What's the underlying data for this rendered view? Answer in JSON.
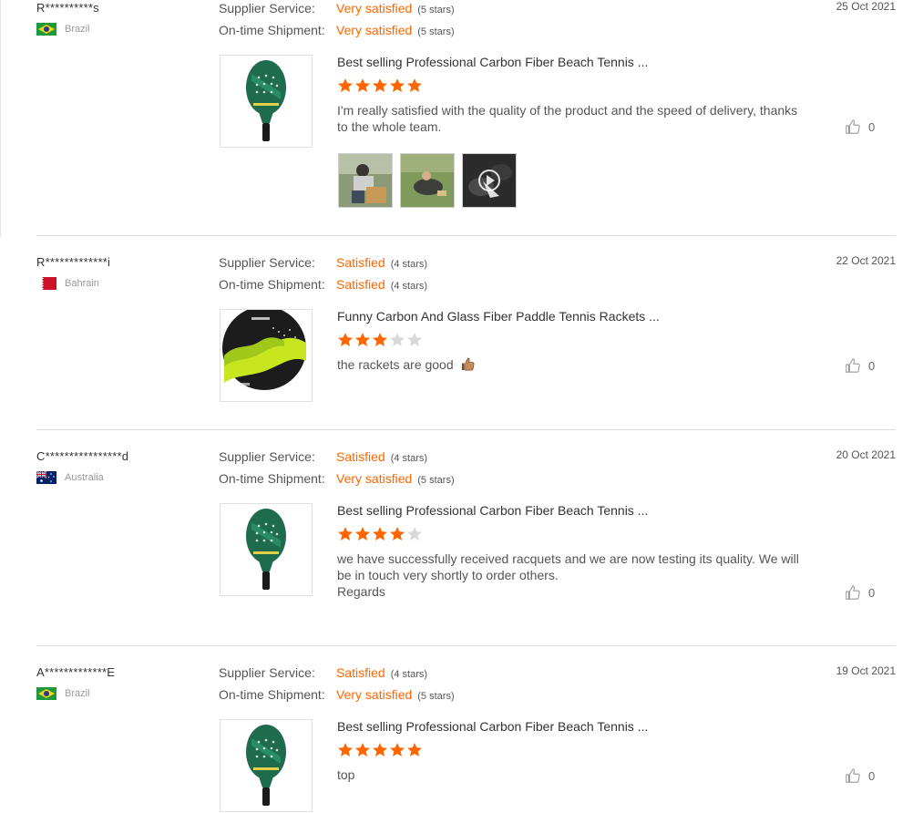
{
  "labels": {
    "supplier_service": "Supplier Service:",
    "ontime_shipment": "On-time Shipment:"
  },
  "colors": {
    "accent": "#ff6600",
    "star_empty": "#d9d9d9",
    "separator": "#dcdcdc"
  },
  "reviews": [
    {
      "buyer": "R**********s",
      "country": "Brazil",
      "flag": "flag-brazil-icon",
      "date": "25 Oct 2021",
      "supplier_value": "Very satisfied",
      "supplier_stars": "(5 stars)",
      "shipment_value": "Very satisfied",
      "shipment_stars": "(5 stars)",
      "product_title": "Best selling Professional Carbon Fiber Beach Tennis ...",
      "rating": 5,
      "comment_lines": [
        "I'm really satisfied with the quality of the product and the speed of delivery, thanks",
        "to the whole team."
      ],
      "likes": "0",
      "product_image": "green-racket-image"
    },
    {
      "buyer": "R*************i",
      "country": "Bahrain",
      "flag": "flag-bahrain-icon",
      "date": "22 Oct 2021",
      "supplier_value": "Satisfied",
      "supplier_stars": "(4 stars)",
      "shipment_value": "Satisfied",
      "shipment_stars": "(4 stars)",
      "product_title": "Funny Carbon And Glass Fiber Paddle Tennis Rackets ...",
      "rating": 3,
      "comment_lines": [
        "the rackets are good"
      ],
      "likes": "0",
      "product_image": "yellow-paddle-racket-image"
    },
    {
      "buyer": "C****************d",
      "country": "Australia",
      "flag": "flag-australia-icon",
      "date": "20 Oct 2021",
      "supplier_value": "Satisfied",
      "supplier_stars": "(4 stars)",
      "shipment_value": "Very satisfied",
      "shipment_stars": "(5 stars)",
      "product_title": "Best selling Professional Carbon Fiber Beach Tennis ...",
      "rating": 4,
      "comment_lines": [
        "we have successfully received racquets and we are now testing its quality. We will",
        "be in touch very shortly to order others.",
        "Regards"
      ],
      "likes": "0",
      "product_image": "green-racket-image"
    },
    {
      "buyer": "A*************E",
      "country": "Brazil",
      "flag": "flag-brazil-icon",
      "date": "19 Oct 2021",
      "supplier_value": "Satisfied",
      "supplier_stars": "(4 stars)",
      "shipment_value": "Very satisfied",
      "shipment_stars": "(5 stars)",
      "product_title": "Best selling Professional Carbon Fiber Beach Tennis ...",
      "rating": 5,
      "comment_lines": [
        "top"
      ],
      "likes": "0",
      "product_image": "green-racket-image"
    }
  ]
}
